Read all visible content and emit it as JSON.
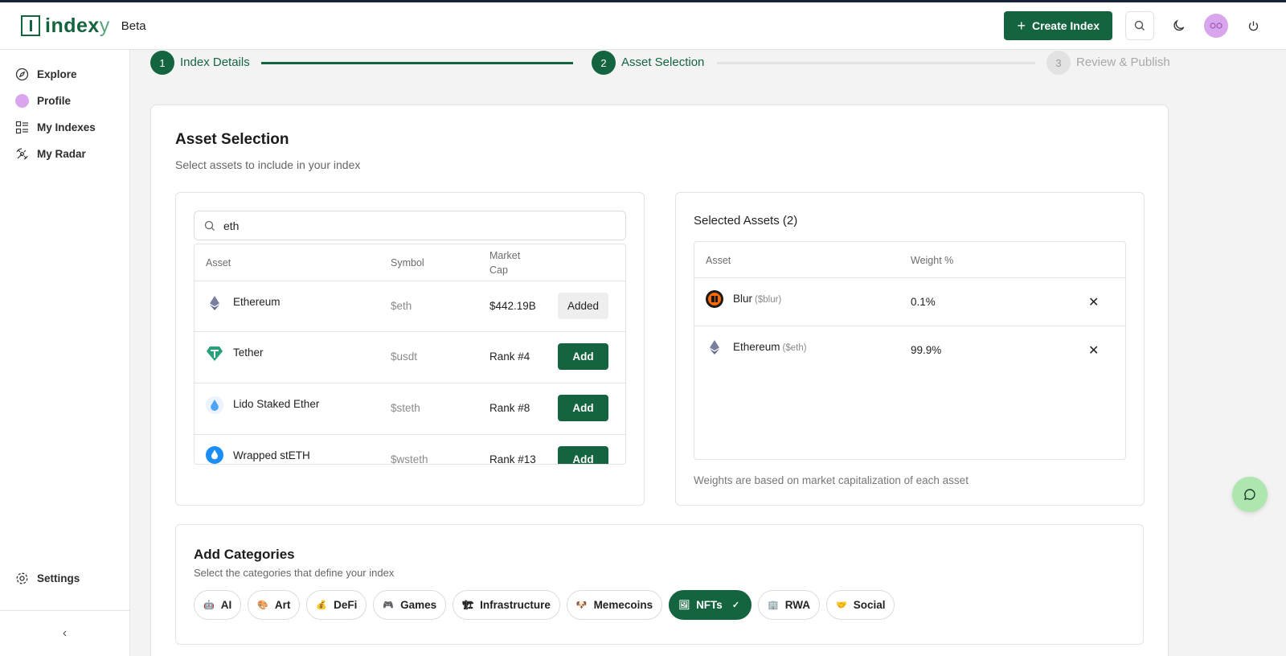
{
  "brand": {
    "logo_main": "index",
    "logo_tail": "y",
    "beta": "Beta"
  },
  "header": {
    "create_label": "Create Index",
    "icons": [
      "search-icon",
      "moon-icon",
      "avatar",
      "power-icon"
    ]
  },
  "sidebar": {
    "items": [
      {
        "label": "Explore",
        "icon": "compass-icon"
      },
      {
        "label": "Profile",
        "icon": "avatar"
      },
      {
        "label": "My Indexes",
        "icon": "list-icon"
      },
      {
        "label": "My Radar",
        "icon": "radar-icon"
      }
    ],
    "settings_label": "Settings",
    "collapse_glyph": "‹"
  },
  "stepper": {
    "steps": [
      {
        "number": "1",
        "label": "Index Details",
        "state": "done"
      },
      {
        "number": "2",
        "label": "Asset Selection",
        "state": "active"
      },
      {
        "number": "3",
        "label": "Review & Publish",
        "state": "inactive"
      }
    ]
  },
  "main": {
    "title": "Asset Selection",
    "subtitle": "Select assets to include in your index"
  },
  "search": {
    "value": "eth",
    "placeholder": ""
  },
  "asset_table": {
    "headers": {
      "asset": "Asset",
      "symbol": "Symbol",
      "market_cap_line1": "Market",
      "market_cap_line2": "Cap"
    },
    "rows": [
      {
        "name": "Ethereum",
        "symbol": "$eth",
        "cap": "$442.19B",
        "action": "Added"
      },
      {
        "name": "Tether",
        "symbol": "$usdt",
        "cap": "Rank #4",
        "action": "Add"
      },
      {
        "name": "Lido Staked Ether",
        "symbol": "$steth",
        "cap": "Rank #8",
        "action": "Add"
      },
      {
        "name": "Wrapped stETH",
        "symbol": "$wsteth",
        "cap": "Rank #13",
        "action": "Add"
      }
    ]
  },
  "selected": {
    "title": "Selected Assets (2)",
    "headers": {
      "asset": "Asset",
      "weight": "Weight %"
    },
    "rows": [
      {
        "name": "Blur",
        "symbol": "($blur)",
        "weight": "0.1%"
      },
      {
        "name": "Ethereum",
        "symbol": "($eth)",
        "weight": "99.9%"
      }
    ],
    "remove_glyph": "✕",
    "note": "Weights are based on market capitalization of each asset"
  },
  "categories": {
    "title": "Add Categories",
    "subtitle": "Select the categories that define your index",
    "items": [
      {
        "label": "AI",
        "emoji": "🤖",
        "selected": false
      },
      {
        "label": "Art",
        "emoji": "🎨",
        "selected": false
      },
      {
        "label": "DeFi",
        "emoji": "💰",
        "selected": false
      },
      {
        "label": "Games",
        "emoji": "🎮",
        "selected": false
      },
      {
        "label": "Infrastructure",
        "emoji": "🏗",
        "selected": false
      },
      {
        "label": "Memecoins",
        "emoji": "🐶",
        "selected": false
      },
      {
        "label": "NFTs",
        "emoji": "🖼",
        "selected": true
      },
      {
        "label": "RWA",
        "emoji": "🏢",
        "selected": false
      },
      {
        "label": "Social",
        "emoji": "🤝",
        "selected": false
      }
    ],
    "check_glyph": "✓"
  },
  "colors": {
    "brand_green": "#14643f",
    "avatar_purple": "#d9a6ee",
    "chat_fab": "#aee6b0"
  }
}
